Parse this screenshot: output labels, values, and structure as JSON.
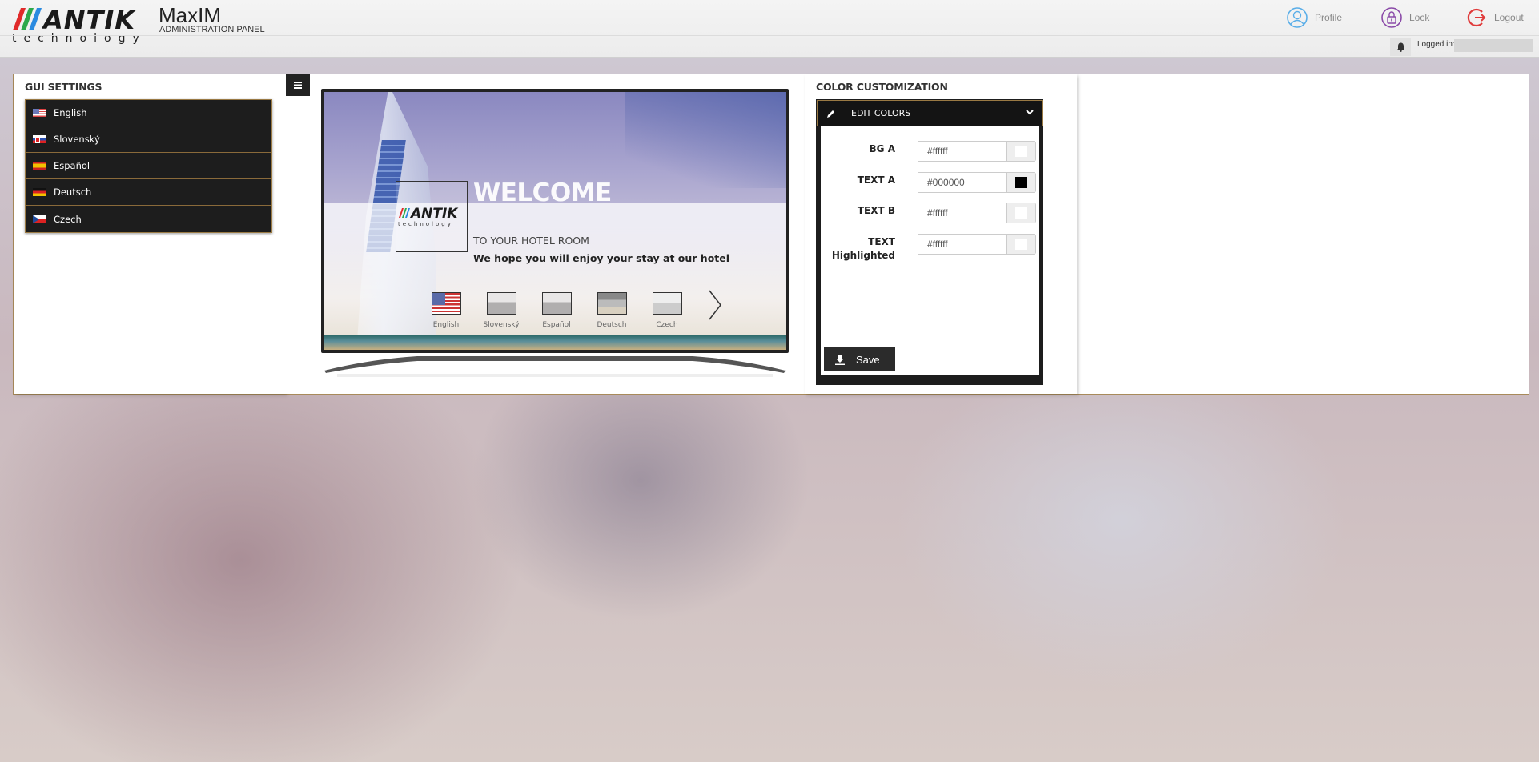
{
  "header": {
    "brand": "ANTIK",
    "brand_sub": "technology",
    "app_title": "MaxIM",
    "app_subtitle": "ADMINISTRATION PANEL",
    "nav": [
      {
        "label": "Profile",
        "icon": "user-icon",
        "color": "#5aaee8"
      },
      {
        "label": "Lock",
        "icon": "lock-icon",
        "color": "#8a4aa8"
      },
      {
        "label": "Logout",
        "icon": "logout-icon",
        "color": "#e03a3a"
      }
    ],
    "logged_in_label": "Logged in:",
    "logged_in_value": ""
  },
  "gui_settings": {
    "title": "GUI SETTINGS",
    "languages": [
      {
        "label": "English",
        "flag": "us"
      },
      {
        "label": "Slovenský",
        "flag": "sk"
      },
      {
        "label": "Español",
        "flag": "es"
      },
      {
        "label": "Deutsch",
        "flag": "de"
      },
      {
        "label": "Czech",
        "flag": "cz"
      }
    ]
  },
  "preview": {
    "menu_icon": "hamburger-icon",
    "logo_word": "ANTIK",
    "logo_sub": "technology",
    "welcome": "WELCOME",
    "subtitle": "TO YOUR HOTEL ROOM",
    "message": "We hope you will enjoy your stay at our hotel",
    "languages": [
      "English",
      "Slovenský",
      "Español",
      "Deutsch",
      "Czech"
    ]
  },
  "color_customization": {
    "title": "COLOR CUSTOMIZATION",
    "section_label": "EDIT COLORS",
    "fields": [
      {
        "label": "BG A",
        "value": "#ffffff",
        "swatch": "#ffffff"
      },
      {
        "label": "TEXT A",
        "value": "#000000",
        "swatch": "#000000"
      },
      {
        "label": "TEXT B",
        "value": "#ffffff",
        "swatch": "#ffffff"
      },
      {
        "label": "TEXT Highlighted",
        "value": "#ffffff",
        "swatch": "#ffffff"
      }
    ],
    "save_label": "Save"
  },
  "colors": {
    "accent_border": "#a88a5a",
    "dark_panel": "#1d1d1d"
  }
}
